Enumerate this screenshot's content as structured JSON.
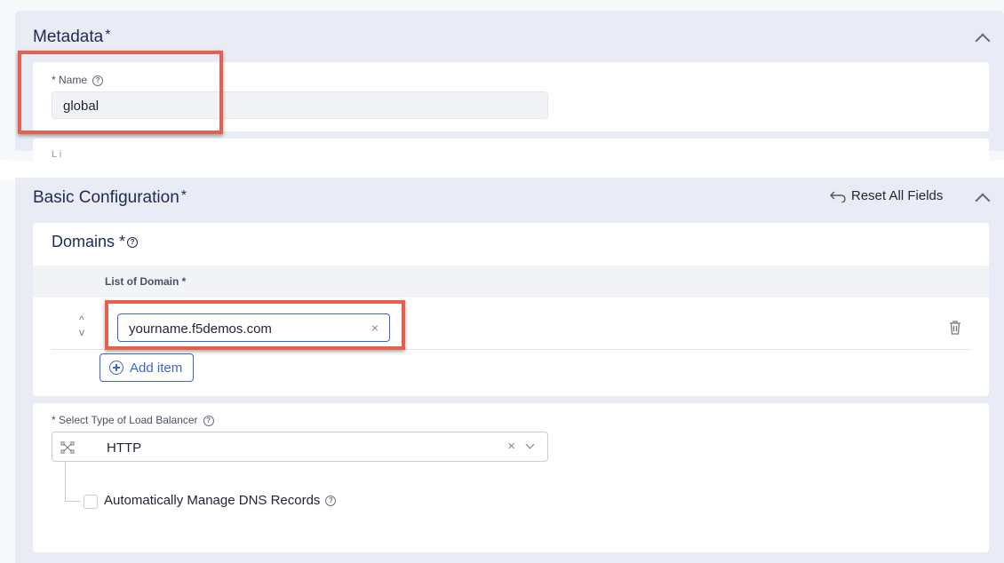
{
  "metadata": {
    "title": "Metadata",
    "required_mark": "*",
    "name_label": "* Name",
    "name_value": "global",
    "cut_label": "L i"
  },
  "basic": {
    "title": "Basic Configuration",
    "required_mark": "*",
    "reset_label": "Reset All Fields"
  },
  "domains": {
    "title": "Domains *",
    "list_header": "List of Domain *",
    "items": [
      "yourname.f5demos.com"
    ],
    "add_label": "Add item"
  },
  "lb": {
    "label": "* Select Type of Load Balancer",
    "value": "HTTP",
    "dns_label": "Automatically Manage DNS Records"
  },
  "icons": [
    "help-icon",
    "chevron-up-icon",
    "reset-icon",
    "trash-icon",
    "clear-icon",
    "chevron-down-icon",
    "network-icon",
    "plus-circle-icon"
  ],
  "colors": {
    "accent": "#3d63d8",
    "highlight": "#e8604c",
    "panel": "#e9ecf5"
  }
}
